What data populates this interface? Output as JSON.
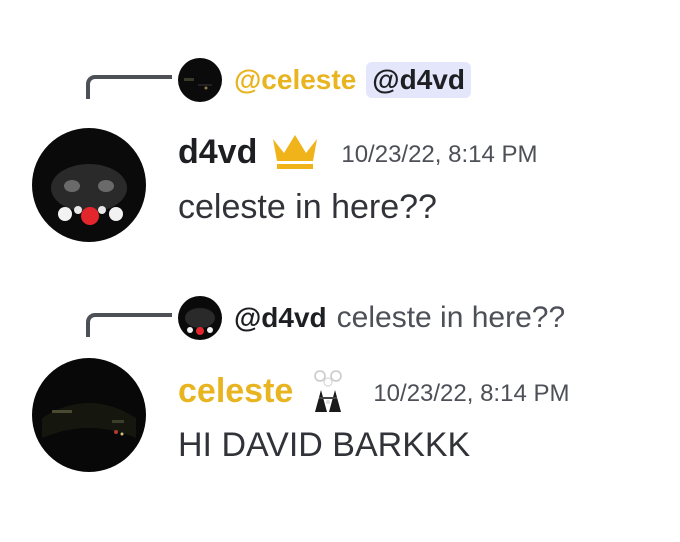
{
  "messages": [
    {
      "reply": {
        "author": "@celeste",
        "mention": "@d4vd",
        "author_color": "#e8b41f"
      },
      "author": "d4vd",
      "author_color": "#1e1f22",
      "role_icon": "crown-icon",
      "role_icon_color": "#f0b31a",
      "timestamp": "10/23/22, 8:14 PM",
      "content": "celeste in here??"
    },
    {
      "reply": {
        "author": "@d4vd",
        "text": "celeste in here??"
      },
      "author": "celeste",
      "author_color": "#e8b41f",
      "role_icon": "custom-badge-icon",
      "timestamp": "10/23/22, 8:14 PM",
      "content": "HI DAVID BARKKK"
    }
  ],
  "colors": {
    "mention_bg": "#e4e6fb",
    "reply_spine": "#4e5058",
    "timestamp": "#4e5058"
  }
}
